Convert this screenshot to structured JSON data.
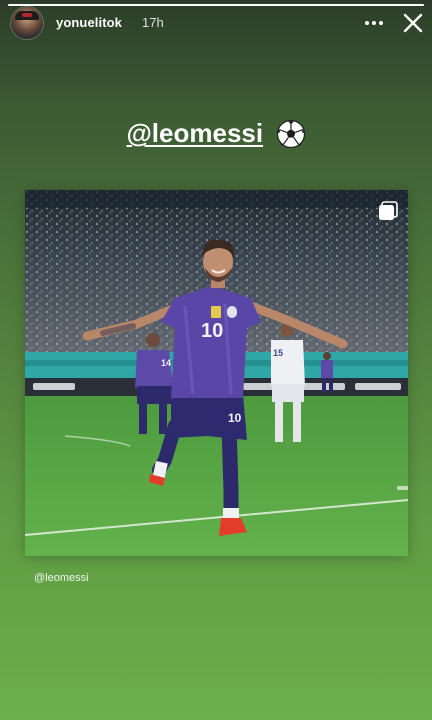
{
  "story": {
    "progress": 1.0,
    "author": {
      "username": "yonuelitok",
      "posted_ago": "17h"
    },
    "mention_sticker": {
      "text": "@leomessi",
      "icon": "soccer-ball-icon"
    },
    "shared_post": {
      "image_icon": "multiple-images-icon",
      "player_number": "10",
      "teammate_number": "14",
      "opponent_number": "15",
      "caption": "@leomessi"
    },
    "controls": {
      "more_icon": "more-options-icon",
      "close_icon": "close-icon"
    }
  },
  "colors": {
    "background_top": "#2c3d29",
    "background_bottom": "#6bb04a",
    "jersey_purple": "#5a46a6",
    "pitch_green": "#58a847"
  }
}
